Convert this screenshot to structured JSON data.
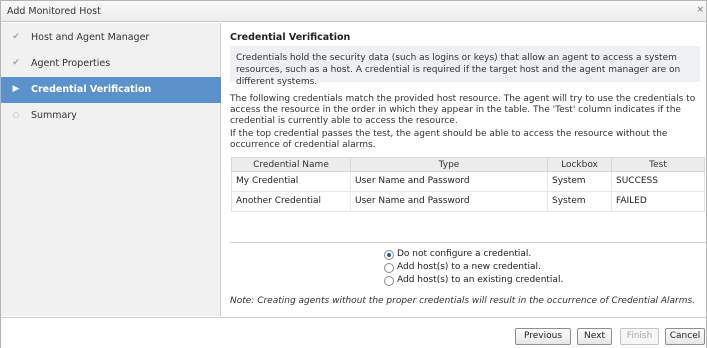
{
  "window": {
    "title": "Add Monitored Host",
    "close_glyph": "×"
  },
  "sidebar": {
    "steps": [
      {
        "label": "Host and Agent Manager",
        "state": "done",
        "icon": "checkmark-icon"
      },
      {
        "label": "Agent Properties",
        "state": "done",
        "icon": "checkmark-icon"
      },
      {
        "label": "Credential Verification",
        "state": "active",
        "icon": "arrow-right-icon"
      },
      {
        "label": "Summary",
        "state": "pending",
        "icon": "circle-icon"
      }
    ]
  },
  "content": {
    "title": "Credential Verification",
    "intro": "Credentials hold the security data (such as logins or keys) that allow an agent to access a system resources, such as a host. A credential is required if the target host and the agent manager are on different systems.",
    "para1": "The following credentials match the provided host resource. The agent will try to use the credentials to access the resource in the order in which they appear in the table. The 'Test' column indicates if the credential is currently able to access the resource.",
    "para2": "If the top credential passes the test, the agent should be able to access the resource without the occurrence of credential alarms.",
    "table": {
      "headers": [
        "Credential Name",
        "Type",
        "Lockbox",
        "Test"
      ],
      "rows": [
        [
          "My Credential",
          "User Name and Password",
          "System",
          "SUCCESS"
        ],
        [
          "Another Credential",
          "User Name and Password",
          "System",
          "FAILED"
        ]
      ]
    },
    "options": [
      {
        "label": "Do not configure a credential.",
        "checked": true
      },
      {
        "label": "Add host(s) to a new credential.",
        "checked": false
      },
      {
        "label": "Add host(s) to an existing credential.",
        "checked": false
      }
    ],
    "note": "Note: Creating agents without the proper credentials will result in the occurrence of Credential Alarms."
  },
  "footer": {
    "previous": "Previous",
    "next": "Next",
    "finish": "Finish",
    "cancel": "Cancel"
  }
}
